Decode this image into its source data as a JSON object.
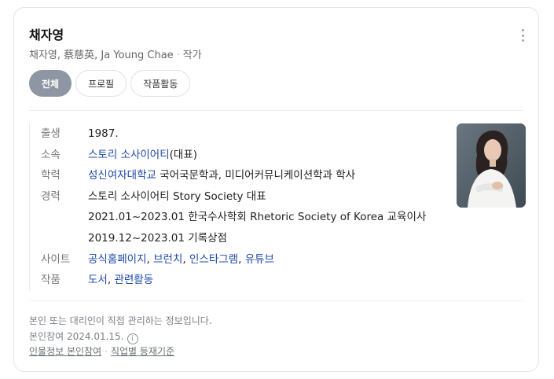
{
  "header": {
    "name": "채자영",
    "aliases": "채자영, 蔡慈英, Ja Young Chae",
    "occupation": "작가",
    "more_icon": "vertical-ellipsis-icon"
  },
  "tabs": [
    {
      "label": "전체",
      "active": true
    },
    {
      "label": "프로필",
      "active": false
    },
    {
      "label": "작품활동",
      "active": false
    }
  ],
  "profile": {
    "birth": {
      "label": "출생",
      "value": "1987."
    },
    "agency": {
      "label": "소속",
      "link": "스토리 소사이어티",
      "suffix": "(대표)"
    },
    "education": {
      "label": "학력",
      "link": "성신여자대학교",
      "suffix": " 국어국문학과, 미디어커뮤니케이션학과 학사"
    },
    "career": {
      "label": "경력",
      "lines": [
        "스토리 소사이어티 Story Society 대표",
        "2021.01~2023.01 한국수사학회 Rhetoric Society of Korea 교육이사",
        "2019.12~2023.01 기록상점"
      ]
    },
    "sites": {
      "label": "사이트",
      "links": [
        "공식홈페이지",
        "브런치",
        "인스타그램",
        "유튜브"
      ]
    },
    "works": {
      "label": "작품",
      "links": [
        "도서",
        "관련활동"
      ]
    }
  },
  "footer": {
    "notice": "본인 또는 대리인이 직접 관리하는 정보입니다.",
    "participation": "본인참여 2024.01.15.",
    "info_icon": "info-circle-icon",
    "links": [
      "인물정보 본인참여",
      "직업별 등재기준"
    ]
  },
  "colors": {
    "link": "#1d49a8",
    "active_tab": "#8e95a3"
  }
}
